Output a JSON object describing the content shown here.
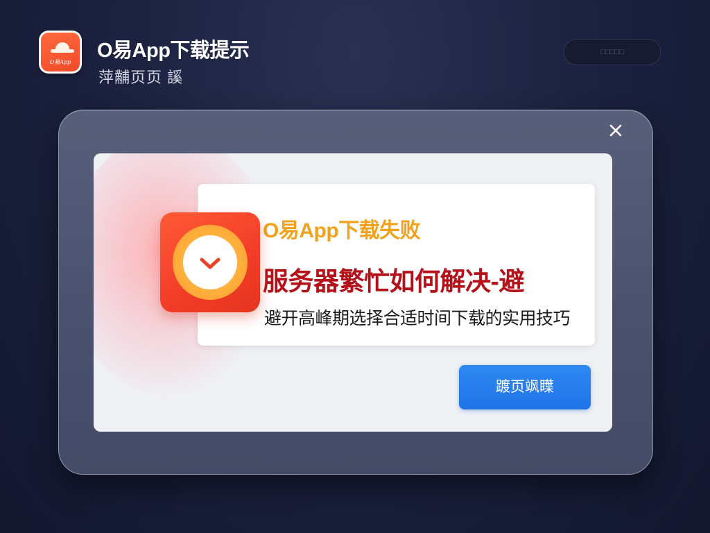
{
  "header": {
    "title": "O易App下载提示",
    "subtitle": "萍黼页页 謑",
    "logo_text": "O易App",
    "top_button_label": "□□□□□"
  },
  "dialog": {
    "close_icon": "close-icon",
    "title": "O易App下载失败",
    "headline": "服务器繁忙如何解决-避",
    "subtitle": "避开高峰期选择合适时间下载的实用技巧",
    "primary_button_label": "踱页飒瞸",
    "icon": "download-icon"
  },
  "colors": {
    "background": "#1c2240",
    "dialog_title": "#f0a21c",
    "headline": "#b4121a",
    "primary_button": "#2a82ee",
    "icon_red": "#f23d28",
    "icon_ring": "#ffb03d"
  }
}
